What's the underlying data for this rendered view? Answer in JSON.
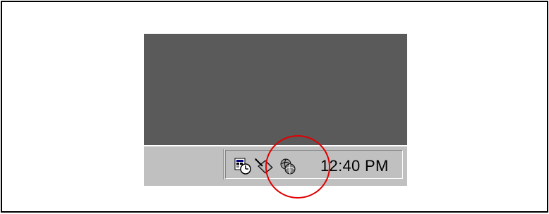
{
  "taskbar": {
    "tray": {
      "clock_text": "12:40 PM",
      "icons": [
        {
          "name": "scheduled-tasks-icon"
        },
        {
          "name": "pen-pad-icon"
        },
        {
          "name": "globe-network-icon"
        }
      ]
    }
  },
  "annotation": {
    "type": "highlight-circle",
    "color": "#e00000"
  },
  "colors": {
    "desktop": "#5a5a5a",
    "taskbar": "#c0c0c0",
    "frame_border": "#000000"
  }
}
